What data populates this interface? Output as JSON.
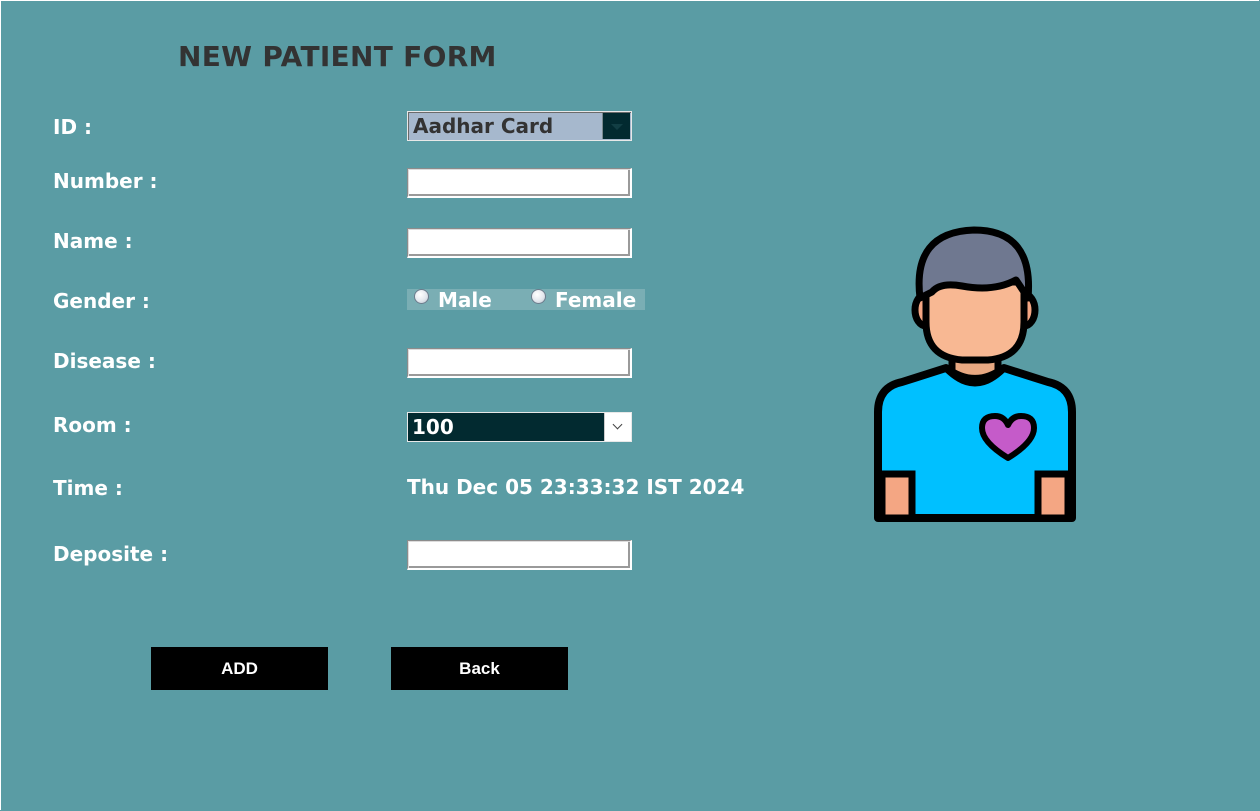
{
  "form": {
    "title": "NEW PATIENT FORM",
    "id_label": "ID :",
    "id_selected": "Aadhar Card",
    "number_label": "Number :",
    "number_value": "",
    "name_label": "Name :",
    "name_value": "",
    "gender_label": "Gender :",
    "gender_options": [
      "Male",
      "Female"
    ],
    "disease_label": "Disease :",
    "disease_value": "",
    "room_label": "Room :",
    "room_selected": "100",
    "time_label": "Time :",
    "time_value": "Thu Dec 05 23:33:32 IST 2024",
    "deposit_label": "Deposite :",
    "deposit_value": ""
  },
  "buttons": {
    "add_label": "ADD",
    "back_label": "Back"
  },
  "icons": {
    "avatar": "patient-avatar-icon",
    "heart": "heart-icon"
  },
  "colors": {
    "background": "#5a9ca4",
    "button": "#000000",
    "shirt": "#00c0ff",
    "heart": "#c55bc9"
  }
}
